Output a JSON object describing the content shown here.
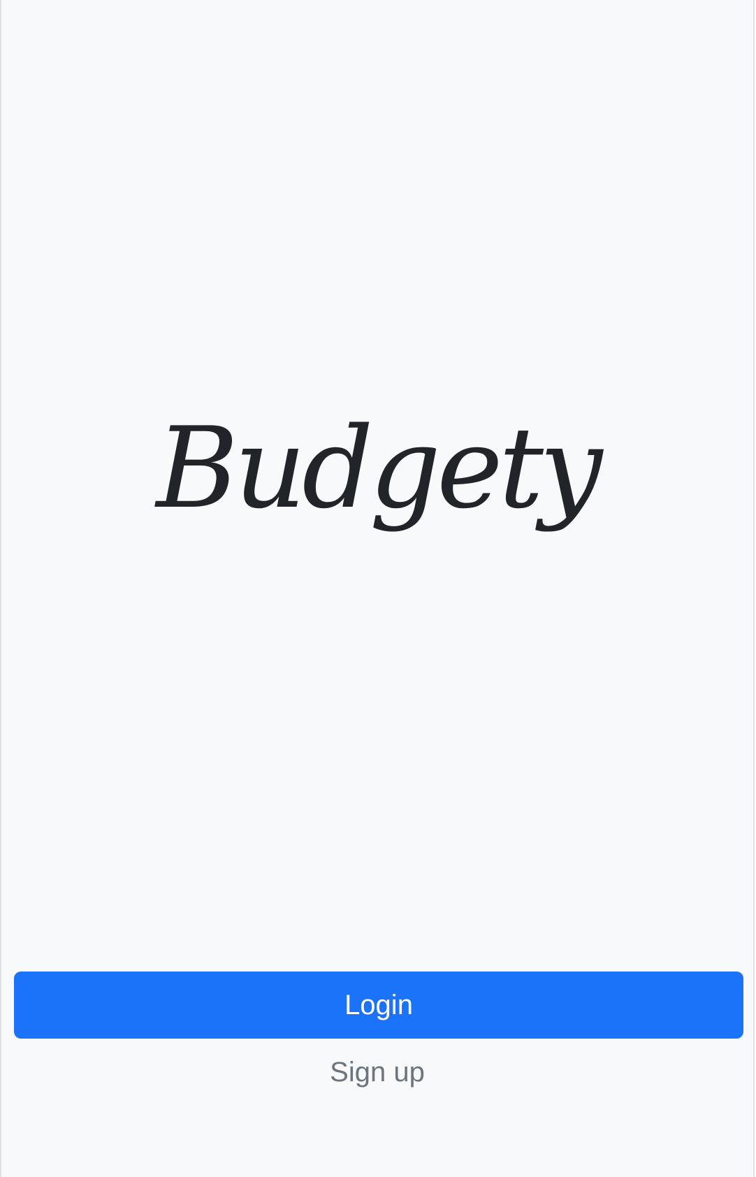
{
  "app": {
    "logo_text": "Budgety"
  },
  "actions": {
    "login_label": "Login",
    "signup_label": "Sign up"
  },
  "colors": {
    "background": "#f8f9fa",
    "primary": "#1a73f8",
    "text_dark": "#212529",
    "text_muted": "#6c757d"
  }
}
